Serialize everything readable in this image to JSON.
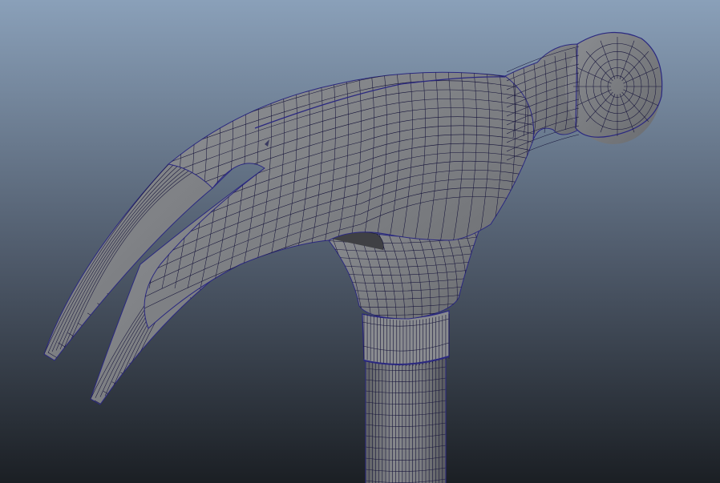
{
  "viewport": {
    "background_top": "#8aa0b9",
    "background_bottom": "#1b1f24",
    "mesh_fill": "#7a7c80",
    "mesh_fill_light": "#8e9094",
    "mesh_fill_dark": "#5f6165",
    "wire_color": "#16143a",
    "edge_highlight": "#2a2880"
  },
  "model": {
    "object": "claw-hammer",
    "parts": [
      "claw",
      "head-body",
      "neck",
      "striking-face",
      "eye-socket",
      "collar",
      "handle"
    ],
    "display_mode": "wireframe-on-shaded"
  }
}
